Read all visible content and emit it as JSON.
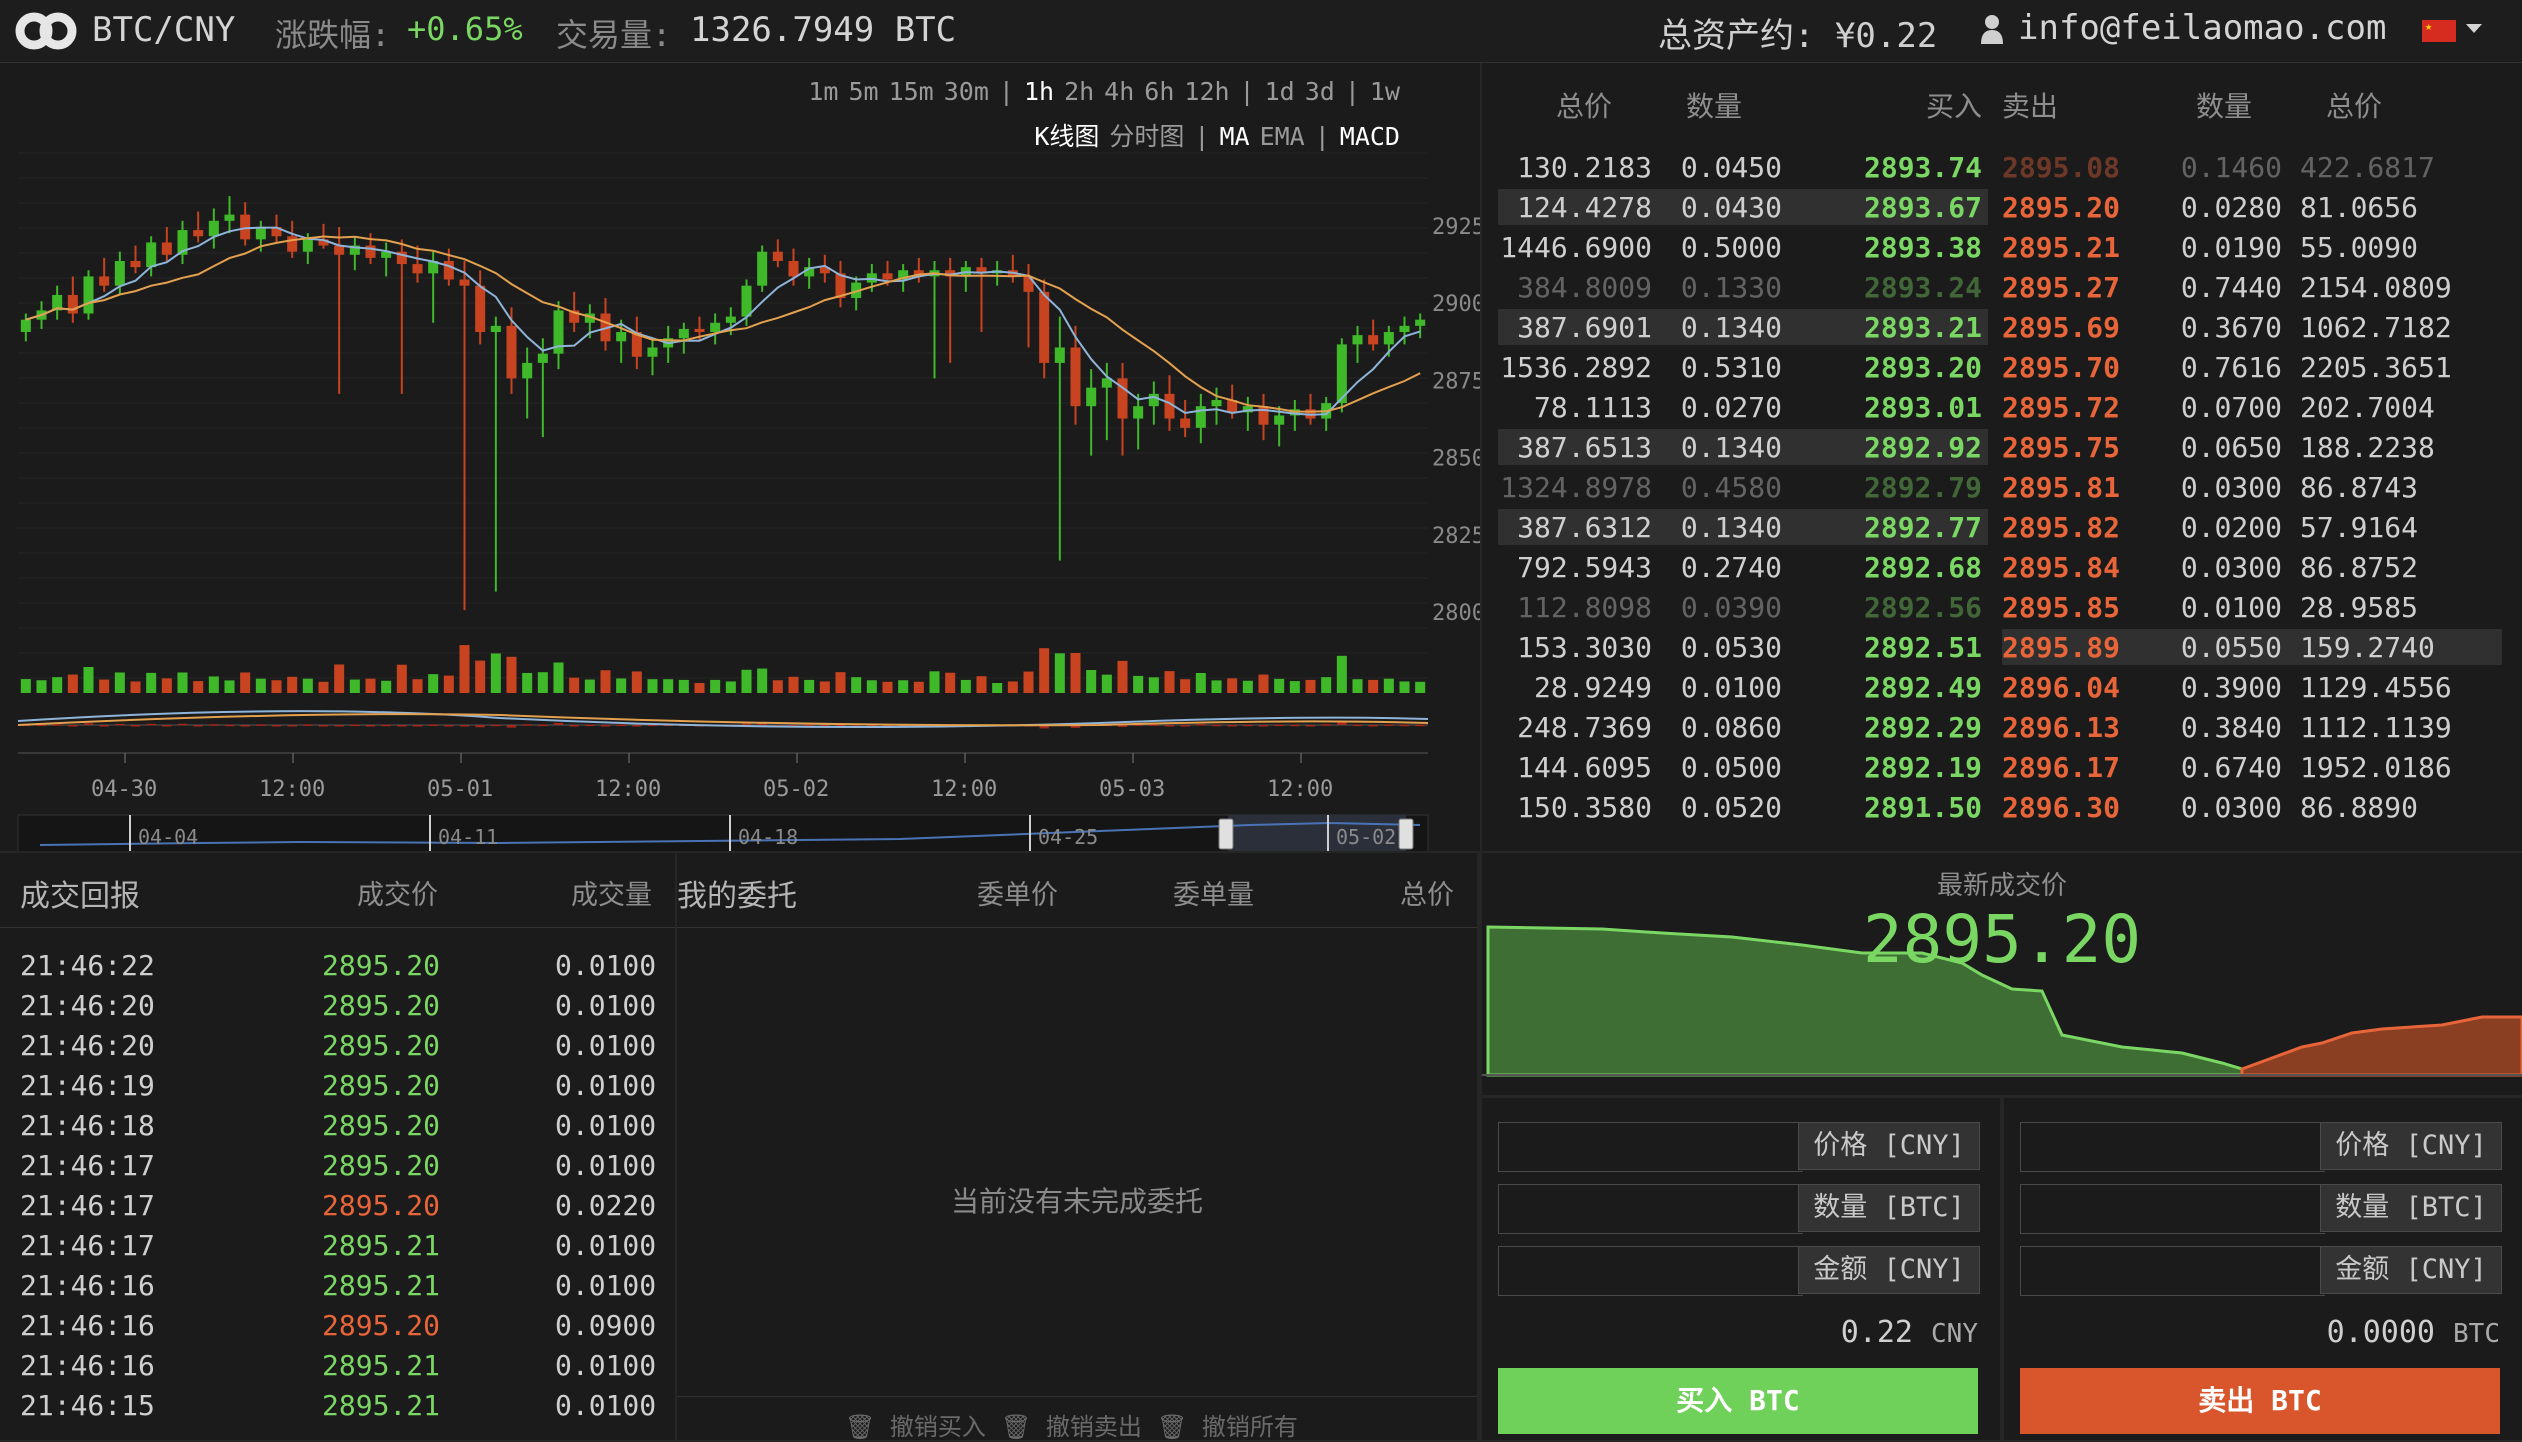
{
  "header": {
    "pair": "BTC/CNY",
    "change_label": "涨跌幅:",
    "change_value": "+0.65%",
    "volume_label": "交易量:",
    "volume_value": "1326.7949 BTC",
    "total_assets": "总资产约: ¥0.22",
    "email": "info@feilaomao.com",
    "user_icon": "user-icon",
    "flag_icon": "china-flag-icon"
  },
  "chart": {
    "timeframes": [
      "1m",
      "5m",
      "15m",
      "30m",
      "|",
      "1h",
      "2h",
      "4h",
      "6h",
      "12h",
      "|",
      "1d",
      "3d",
      "|",
      "1w"
    ],
    "selected_timeframe": "1h",
    "chart_modes": [
      "K线图",
      "分时图",
      "|",
      "MA",
      "EMA",
      "|",
      "MACD"
    ],
    "selected_modes": [
      "K线图",
      "MA",
      "MACD"
    ]
  },
  "chart_data": {
    "type": "candlestick",
    "y_tick_labels": [
      "2925",
      "2900",
      "2875",
      "2850",
      "2825",
      "2800"
    ],
    "ylim": [
      2790,
      2935
    ],
    "x_tick_labels": [
      "04-30",
      "12:00",
      "05-01",
      "12:00",
      "05-02",
      "12:00",
      "05-03",
      "12:00"
    ],
    "navigator_labels": [
      "04-04",
      "04-11",
      "04-18",
      "04-25",
      "05-02"
    ],
    "colors": {
      "up": "#3fb82a",
      "down": "#c8431f",
      "ma_fast": "#8fb4d9",
      "ma_slow": "#e3a04e"
    },
    "series": [
      {
        "name": "OHLC",
        "values": [
          [
            2890,
            2896,
            2887,
            2894
          ],
          [
            2894,
            2900,
            2891,
            2897
          ],
          [
            2897,
            2905,
            2894,
            2902
          ],
          [
            2902,
            2908,
            2893,
            2896
          ],
          [
            2896,
            2910,
            2894,
            2908
          ],
          [
            2908,
            2914,
            2903,
            2905
          ],
          [
            2905,
            2916,
            2902,
            2913
          ],
          [
            2913,
            2918,
            2909,
            2911
          ],
          [
            2911,
            2921,
            2908,
            2919
          ],
          [
            2919,
            2924,
            2913,
            2915
          ],
          [
            2915,
            2926,
            2912,
            2923
          ],
          [
            2923,
            2929,
            2919,
            2921
          ],
          [
            2921,
            2930,
            2917,
            2926
          ],
          [
            2926,
            2934,
            2922,
            2928
          ],
          [
            2928,
            2932,
            2918,
            2920
          ],
          [
            2920,
            2926,
            2916,
            2924
          ],
          [
            2924,
            2928,
            2919,
            2921
          ],
          [
            2921,
            2926,
            2914,
            2916
          ],
          [
            2916,
            2922,
            2912,
            2920
          ],
          [
            2920,
            2925,
            2917,
            2918
          ],
          [
            2918,
            2924,
            2870,
            2915
          ],
          [
            2915,
            2921,
            2910,
            2918
          ],
          [
            2918,
            2922,
            2912,
            2914
          ],
          [
            2914,
            2919,
            2908,
            2916
          ],
          [
            2916,
            2920,
            2870,
            2912
          ],
          [
            2912,
            2918,
            2906,
            2909
          ],
          [
            2909,
            2916,
            2893,
            2913
          ],
          [
            2913,
            2917,
            2905,
            2907
          ],
          [
            2907,
            2913,
            2800,
            2905
          ],
          [
            2905,
            2910,
            2886,
            2890
          ],
          [
            2890,
            2895,
            2806,
            2892
          ],
          [
            2892,
            2898,
            2870,
            2875
          ],
          [
            2875,
            2885,
            2862,
            2880
          ],
          [
            2880,
            2888,
            2856,
            2883
          ],
          [
            2883,
            2900,
            2878,
            2897
          ],
          [
            2897,
            2903,
            2890,
            2893
          ],
          [
            2893,
            2899,
            2888,
            2896
          ],
          [
            2896,
            2901,
            2884,
            2887
          ],
          [
            2887,
            2894,
            2880,
            2890
          ],
          [
            2890,
            2895,
            2878,
            2882
          ],
          [
            2882,
            2888,
            2876,
            2885
          ],
          [
            2885,
            2892,
            2880,
            2888
          ],
          [
            2888,
            2893,
            2883,
            2891
          ],
          [
            2891,
            2895,
            2887,
            2890
          ],
          [
            2890,
            2896,
            2886,
            2893
          ],
          [
            2893,
            2898,
            2889,
            2895
          ],
          [
            2895,
            2907,
            2892,
            2905
          ],
          [
            2905,
            2918,
            2903,
            2916
          ],
          [
            2916,
            2920,
            2911,
            2913
          ],
          [
            2913,
            2917,
            2905,
            2908
          ],
          [
            2908,
            2914,
            2904,
            2911
          ],
          [
            2911,
            2915,
            2906,
            2909
          ],
          [
            2909,
            2913,
            2898,
            2901
          ],
          [
            2901,
            2908,
            2897,
            2906
          ],
          [
            2906,
            2912,
            2903,
            2909
          ],
          [
            2909,
            2913,
            2905,
            2907
          ],
          [
            2907,
            2912,
            2903,
            2910
          ],
          [
            2910,
            2914,
            2906,
            2908
          ],
          [
            2908,
            2913,
            2875,
            2910
          ],
          [
            2910,
            2914,
            2880,
            2908
          ],
          [
            2908,
            2913,
            2903,
            2911
          ],
          [
            2911,
            2914,
            2890,
            2909
          ],
          [
            2909,
            2913,
            2905,
            2910
          ],
          [
            2910,
            2915,
            2906,
            2908
          ],
          [
            2908,
            2912,
            2885,
            2903
          ],
          [
            2903,
            2907,
            2875,
            2880
          ],
          [
            2880,
            2895,
            2816,
            2885
          ],
          [
            2885,
            2892,
            2860,
            2866
          ],
          [
            2866,
            2878,
            2850,
            2872
          ],
          [
            2872,
            2880,
            2855,
            2875
          ],
          [
            2875,
            2880,
            2850,
            2862
          ],
          [
            2862,
            2870,
            2852,
            2866
          ],
          [
            2866,
            2874,
            2860,
            2870
          ],
          [
            2870,
            2876,
            2858,
            2862
          ],
          [
            2862,
            2868,
            2856,
            2859
          ],
          [
            2859,
            2870,
            2854,
            2866
          ],
          [
            2866,
            2872,
            2860,
            2868
          ],
          [
            2868,
            2873,
            2862,
            2864
          ],
          [
            2864,
            2869,
            2858,
            2866
          ],
          [
            2866,
            2870,
            2855,
            2860
          ],
          [
            2860,
            2866,
            2853,
            2863
          ],
          [
            2863,
            2868,
            2858,
            2865
          ],
          [
            2865,
            2870,
            2860,
            2862
          ],
          [
            2862,
            2869,
            2858,
            2867
          ],
          [
            2867,
            2888,
            2864,
            2886
          ],
          [
            2886,
            2892,
            2880,
            2889
          ],
          [
            2889,
            2894,
            2884,
            2886
          ],
          [
            2886,
            2892,
            2882,
            2890
          ],
          [
            2890,
            2895,
            2886,
            2892
          ],
          [
            2892,
            2896,
            2888,
            2894
          ]
        ]
      }
    ]
  },
  "orderbook": {
    "headers": [
      "总价",
      "数量",
      "买入",
      "卖出",
      "数量",
      "总价"
    ],
    "rows": [
      {
        "b_total": "130.2183",
        "b_qty": "0.0450",
        "bid": "2893.74",
        "ask": "2895.08",
        "a_qty": "0.1460",
        "a_total": "422.6817",
        "ask_faded": true
      },
      {
        "b_total": "124.4278",
        "b_qty": "0.0430",
        "bid": "2893.67",
        "ask": "2895.20",
        "a_qty": "0.0280",
        "a_total": "81.0656",
        "hl_bid": true
      },
      {
        "b_total": "1446.6900",
        "b_qty": "0.5000",
        "bid": "2893.38",
        "ask": "2895.21",
        "a_qty": "0.0190",
        "a_total": "55.0090"
      },
      {
        "b_total": "384.8009",
        "b_qty": "0.1330",
        "bid": "2893.24",
        "ask": "2895.27",
        "a_qty": "0.7440",
        "a_total": "2154.0809",
        "bid_faded": true
      },
      {
        "b_total": "387.6901",
        "b_qty": "0.1340",
        "bid": "2893.21",
        "ask": "2895.69",
        "a_qty": "0.3670",
        "a_total": "1062.7182",
        "hl_bid": true
      },
      {
        "b_total": "1536.2892",
        "b_qty": "0.5310",
        "bid": "2893.20",
        "ask": "2895.70",
        "a_qty": "0.7616",
        "a_total": "2205.3651"
      },
      {
        "b_total": "78.1113",
        "b_qty": "0.0270",
        "bid": "2893.01",
        "ask": "2895.72",
        "a_qty": "0.0700",
        "a_total": "202.7004"
      },
      {
        "b_total": "387.6513",
        "b_qty": "0.1340",
        "bid": "2892.92",
        "ask": "2895.75",
        "a_qty": "0.0650",
        "a_total": "188.2238",
        "hl_bid": true
      },
      {
        "b_total": "1324.8978",
        "b_qty": "0.4580",
        "bid": "2892.79",
        "ask": "2895.81",
        "a_qty": "0.0300",
        "a_total": "86.8743",
        "bid_faded": true
      },
      {
        "b_total": "387.6312",
        "b_qty": "0.1340",
        "bid": "2892.77",
        "ask": "2895.82",
        "a_qty": "0.0200",
        "a_total": "57.9164",
        "hl_bid": true
      },
      {
        "b_total": "792.5943",
        "b_qty": "0.2740",
        "bid": "2892.68",
        "ask": "2895.84",
        "a_qty": "0.0300",
        "a_total": "86.8752"
      },
      {
        "b_total": "112.8098",
        "b_qty": "0.0390",
        "bid": "2892.56",
        "ask": "2895.85",
        "a_qty": "0.0100",
        "a_total": "28.9585",
        "bid_faded": true
      },
      {
        "b_total": "153.3030",
        "b_qty": "0.0530",
        "bid": "2892.51",
        "ask": "2895.89",
        "a_qty": "0.0550",
        "a_total": "159.2740",
        "hl_ask": true
      },
      {
        "b_total": "28.9249",
        "b_qty": "0.0100",
        "bid": "2892.49",
        "ask": "2896.04",
        "a_qty": "0.3900",
        "a_total": "1129.4556"
      },
      {
        "b_total": "248.7369",
        "b_qty": "0.0860",
        "bid": "2892.29",
        "ask": "2896.13",
        "a_qty": "0.3840",
        "a_total": "1112.1139"
      },
      {
        "b_total": "144.6095",
        "b_qty": "0.0500",
        "bid": "2892.19",
        "ask": "2896.17",
        "a_qty": "0.6740",
        "a_total": "1952.0186"
      },
      {
        "b_total": "150.3580",
        "b_qty": "0.0520",
        "bid": "2891.50",
        "ask": "2896.30",
        "a_qty": "0.0300",
        "a_total": "86.8890"
      }
    ]
  },
  "trades": {
    "title": "成交回报",
    "col_price": "成交价",
    "col_amount": "成交量",
    "rows": [
      {
        "time": "21:46:22",
        "price": "2895.20",
        "amount": "0.0100",
        "side": "buy"
      },
      {
        "time": "21:46:20",
        "price": "2895.20",
        "amount": "0.0100",
        "side": "buy"
      },
      {
        "time": "21:46:20",
        "price": "2895.20",
        "amount": "0.0100",
        "side": "buy"
      },
      {
        "time": "21:46:19",
        "price": "2895.20",
        "amount": "0.0100",
        "side": "buy"
      },
      {
        "time": "21:46:18",
        "price": "2895.20",
        "amount": "0.0100",
        "side": "buy"
      },
      {
        "time": "21:46:17",
        "price": "2895.20",
        "amount": "0.0100",
        "side": "buy"
      },
      {
        "time": "21:46:17",
        "price": "2895.20",
        "amount": "0.0220",
        "side": "sell"
      },
      {
        "time": "21:46:17",
        "price": "2895.21",
        "amount": "0.0100",
        "side": "buy"
      },
      {
        "time": "21:46:16",
        "price": "2895.21",
        "amount": "0.0100",
        "side": "buy"
      },
      {
        "time": "21:46:16",
        "price": "2895.20",
        "amount": "0.0900",
        "side": "sell"
      },
      {
        "time": "21:46:16",
        "price": "2895.21",
        "amount": "0.0100",
        "side": "buy"
      },
      {
        "time": "21:46:15",
        "price": "2895.21",
        "amount": "0.0100",
        "side": "buy"
      }
    ]
  },
  "my_orders": {
    "title": "我的委托",
    "col_price": "委单价",
    "col_qty": "委单量",
    "col_total": "总价",
    "empty": "当前没有未完成委托",
    "cancel_buy": "撤销买入",
    "cancel_sell": "撤销卖出",
    "cancel_all": "撤销所有",
    "trash_icon": "trash-icon"
  },
  "latest": {
    "label": "最新成交价",
    "price": "2895.20"
  },
  "buy_form": {
    "price_label": "价格 [CNY]",
    "qty_label": "数量 [BTC]",
    "amount_label": "金额 [CNY]",
    "price_value": "",
    "qty_value": "",
    "amount_value": "",
    "balance_value": "0.22",
    "balance_unit": "CNY",
    "button": "买入 BTC",
    "color": "#6fd05a"
  },
  "sell_form": {
    "price_label": "价格 [CNY]",
    "qty_label": "数量 [BTC]",
    "amount_label": "金额 [CNY]",
    "price_value": "",
    "qty_value": "",
    "amount_value": "",
    "balance_value": "0.0000",
    "balance_unit": "BTC",
    "button": "卖出 BTC",
    "color": "#d9552c"
  }
}
